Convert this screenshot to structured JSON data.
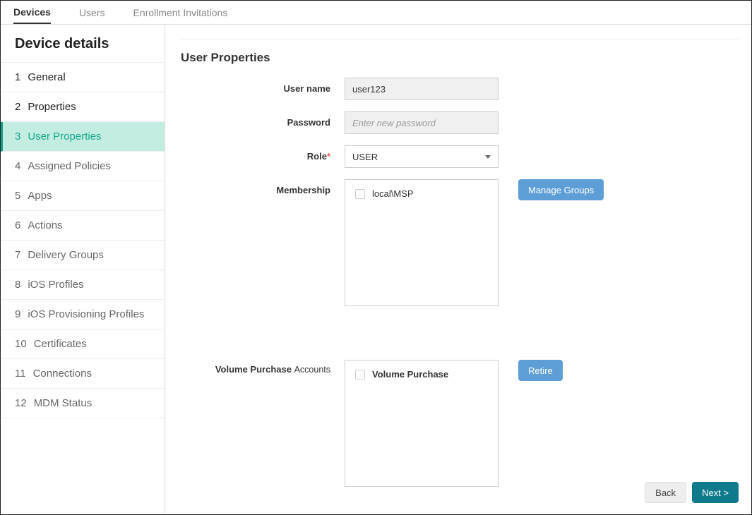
{
  "topTabs": {
    "devices": "Devices",
    "users": "Users",
    "enrollment": "Enrollment Invitations"
  },
  "sidebar": {
    "title": "Device details",
    "items": [
      {
        "num": "1",
        "label": "General"
      },
      {
        "num": "2",
        "label": "Properties"
      },
      {
        "num": "3",
        "label": "User Properties"
      },
      {
        "num": "4",
        "label": "Assigned Policies"
      },
      {
        "num": "5",
        "label": "Apps"
      },
      {
        "num": "6",
        "label": "Actions"
      },
      {
        "num": "7",
        "label": "Delivery Groups"
      },
      {
        "num": "8",
        "label": "iOS Profiles"
      },
      {
        "num": "9",
        "label": "iOS Provisioning Profiles"
      },
      {
        "num": "10",
        "label": "Certificates"
      },
      {
        "num": "11",
        "label": "Connections"
      },
      {
        "num": "12",
        "label": "MDM Status"
      }
    ]
  },
  "main": {
    "title": "User Properties",
    "username_label": "User name",
    "username_value": "user123",
    "password_label": "Password",
    "password_placeholder": "Enter new password",
    "role_label": "Role",
    "role_value": "USER",
    "membership_label": "Membership",
    "membership_item": "local\\MSP",
    "manage_groups_btn": "Manage Groups",
    "vp_label_main": "Volume Purchase ",
    "vp_label_sub": "Accounts",
    "vp_item": "Volume Purchase",
    "retire_btn": "Retire"
  },
  "footer": {
    "back": "Back",
    "next": "Next >"
  }
}
